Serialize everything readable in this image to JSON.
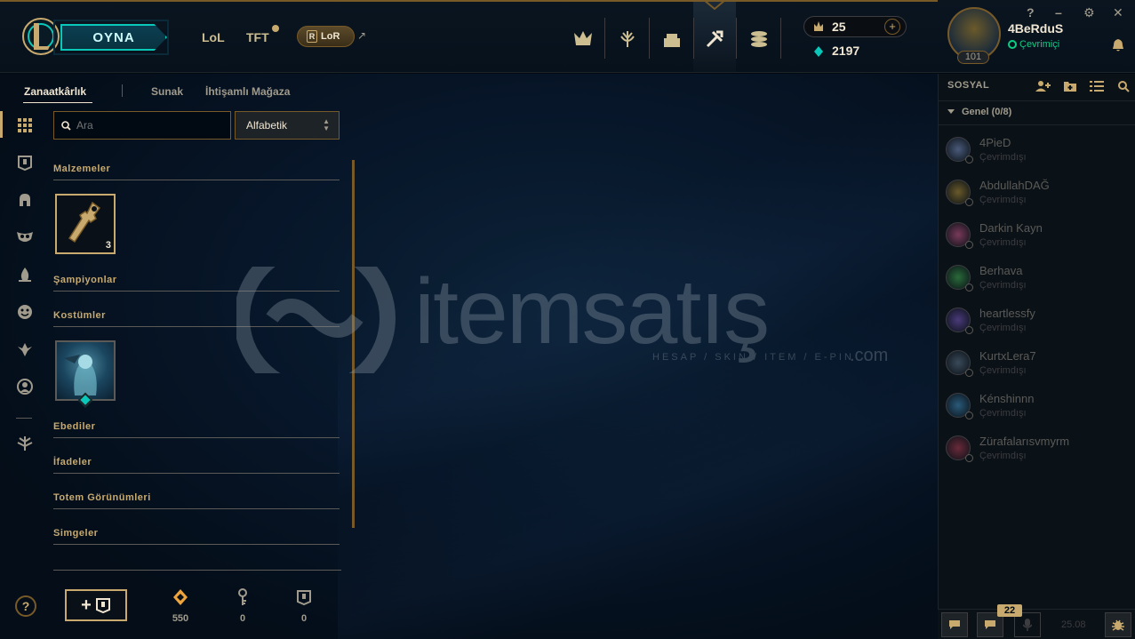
{
  "topbar": {
    "play_label": "OYNA",
    "tabs": [
      "LoL",
      "TFT"
    ],
    "lor_label": "LoR",
    "rp": "25",
    "be": "2197",
    "username": "4BeRduS",
    "status": "Çevrimiçi",
    "level": "101"
  },
  "subnav": {
    "tabs": [
      "Zanaatkârlık",
      "Sunak",
      "İhtişamlı Mağaza"
    ]
  },
  "search": {
    "placeholder": "Ara"
  },
  "sort": {
    "selected": "Alfabetik"
  },
  "categories": {
    "materials": "Malzemeler",
    "champions": "Şampiyonlar",
    "skins": "Kostümler",
    "eternals": "Ebediler",
    "emotes": "İfadeler",
    "ward_skins": "Totem Görünümleri",
    "icons": "Simgeler"
  },
  "key_item": {
    "count": "3"
  },
  "currencies": {
    "orange_essence": "550",
    "keys": "0",
    "chests": "0"
  },
  "watermark": {
    "text": "itemsatış",
    "sub": "HESAP / SKIN / ITEM / E-PIN",
    "domain": ".com"
  },
  "social": {
    "title": "SOSYAL",
    "group": "Genel (0/8)",
    "friends": [
      {
        "name": "4PieD",
        "status": "Çevrimdışı"
      },
      {
        "name": "AbdullahDAĞ",
        "status": "Çevrimdışı"
      },
      {
        "name": "Darkin Kayn",
        "status": "Çevrimdışı"
      },
      {
        "name": "Berhava",
        "status": "Çevrimdışı"
      },
      {
        "name": "heartlessfy",
        "status": "Çevrimdışı"
      },
      {
        "name": "KurtxLera7",
        "status": "Çevrimdışı"
      },
      {
        "name": "Kénshinnn",
        "status": "Çevrimdışı"
      },
      {
        "name": "Zürafalarısvmyrm",
        "status": "Çevrimdışı"
      }
    ],
    "badge": "22",
    "version": "25.08"
  },
  "colors": {
    "gold": "#c8aa6e",
    "teal": "#0ac8b9",
    "online": "#0acf83"
  }
}
